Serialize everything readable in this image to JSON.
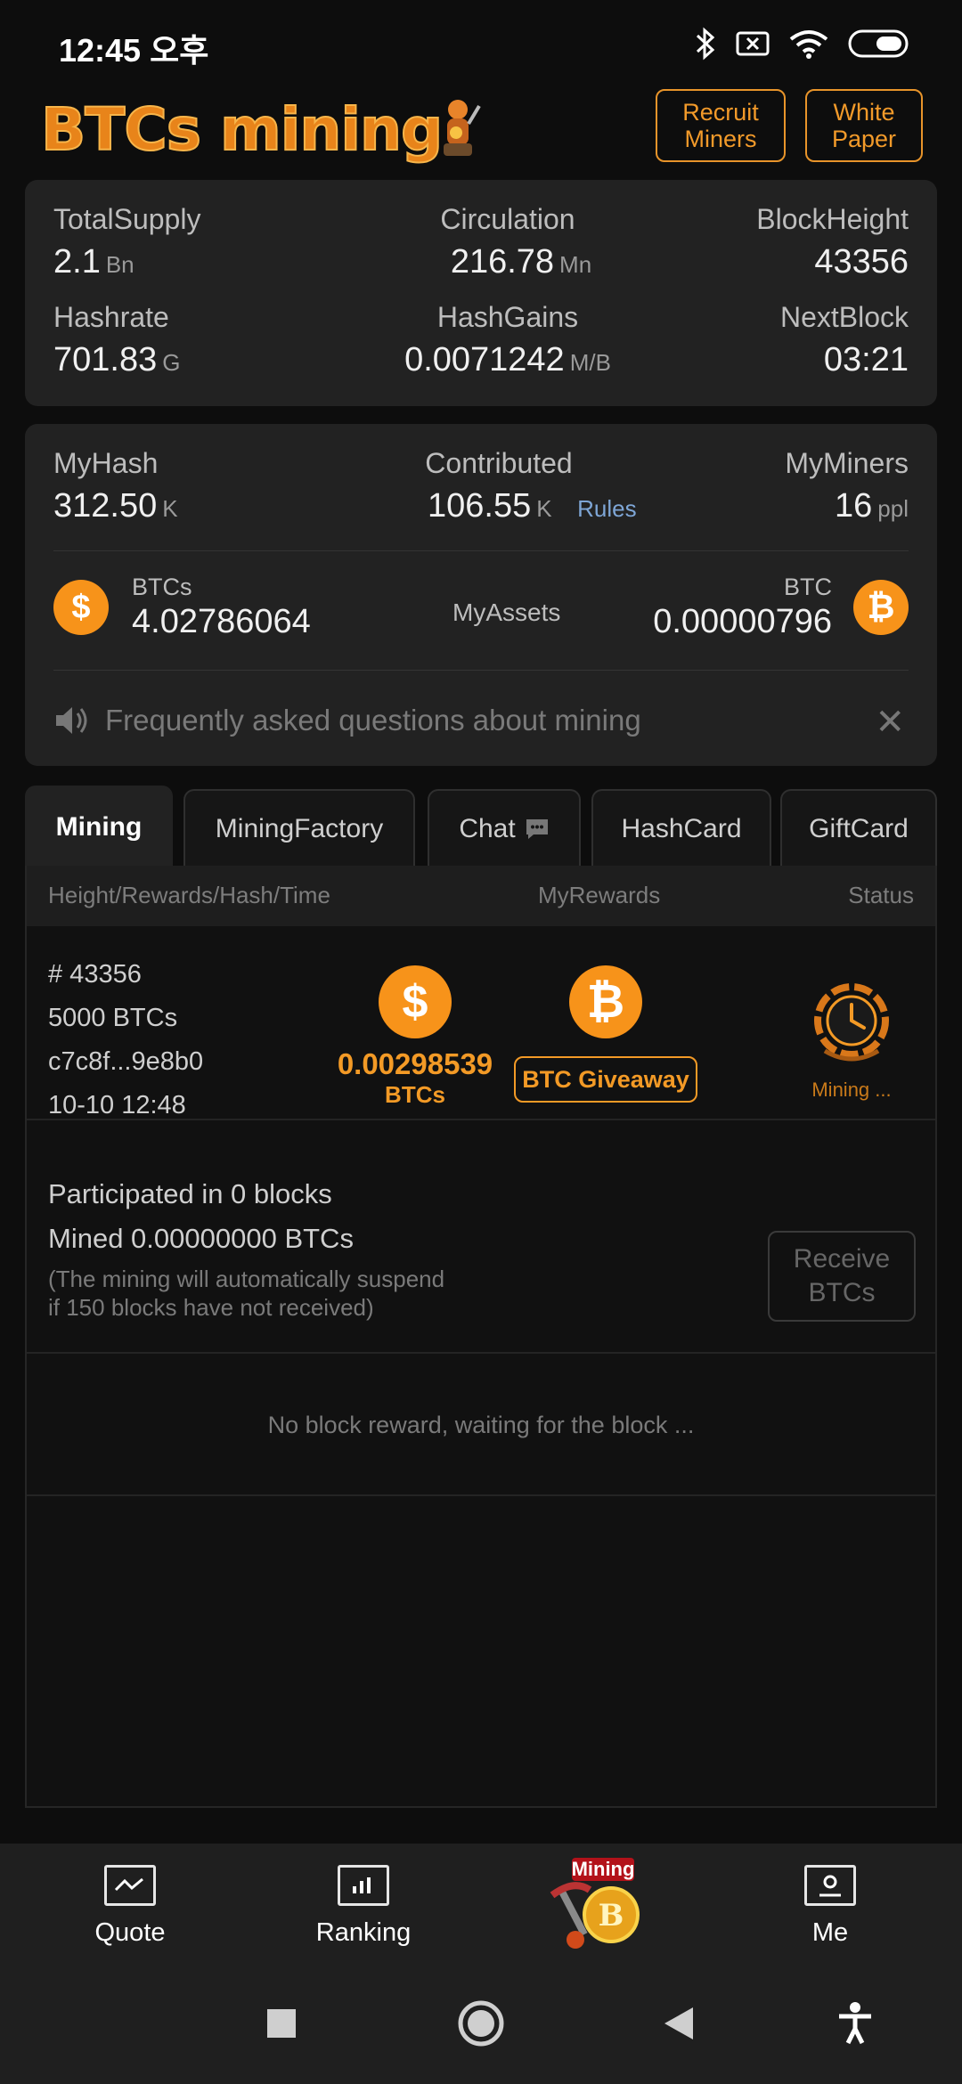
{
  "status_bar": {
    "time": "12:45 오후"
  },
  "header": {
    "logo_text": "BTCs mining",
    "recruit_label": "Recruit Miners",
    "whitepaper_label": "White Paper"
  },
  "stats": {
    "total_supply": {
      "label": "TotalSupply",
      "value": "2.1",
      "unit": "Bn"
    },
    "circulation": {
      "label": "Circulation",
      "value": "216.78",
      "unit": "Mn"
    },
    "block_height": {
      "label": "BlockHeight",
      "value": "43356"
    },
    "hashrate": {
      "label": "Hashrate",
      "value": "701.83",
      "unit": "G"
    },
    "hash_gains": {
      "label": "HashGains",
      "value": "0.0071242",
      "unit": "M/B"
    },
    "next_block": {
      "label": "NextBlock",
      "value": "03:21"
    }
  },
  "my": {
    "my_hash": {
      "label": "MyHash",
      "value": "312.50",
      "unit": "K"
    },
    "contributed": {
      "label": "Contributed",
      "value": "106.55",
      "unit": "K",
      "rules": "Rules"
    },
    "my_miners": {
      "label": "MyMiners",
      "value": "16",
      "unit": "ppl"
    },
    "btcs": {
      "label": "BTCs",
      "value": "4.02786064",
      "icon": "$"
    },
    "assets_label": "MyAssets",
    "btc": {
      "label": "BTC",
      "value": "0.00000796",
      "icon": "₿"
    },
    "faq": "Frequently asked questions about mining",
    "close": "✕"
  },
  "tabs": {
    "mining": "Mining",
    "factory": "MiningFactory",
    "chat": "Chat",
    "hashcard": "HashCard",
    "giftcard": "GiftCard"
  },
  "table": {
    "col1": "Height/Rewards/Hash/Time",
    "col2": "MyRewards",
    "col3": "Status",
    "row": {
      "height": "# 43356",
      "rewards": "5000 BTCs",
      "hash": "c7c8f...9e8b0",
      "time": "10-10 12:48",
      "btcs_icon": "$",
      "my_amount": "0.00298539",
      "my_unit": "BTCs",
      "btc_icon": "₿",
      "giveaway": "BTC Giveaway",
      "status": "Mining ..."
    }
  },
  "participation": {
    "line1": "Participated in 0 blocks",
    "line2": "Mined 0.00000000 BTCs",
    "note1": "(The mining will automatically suspend",
    "note2": "if 150 blocks have not received)",
    "receive": "Receive BTCs"
  },
  "empty_message": "No block reward, waiting for the block ...",
  "bottom_nav": {
    "quote": "Quote",
    "ranking": "Ranking",
    "mining_badge": "Mining",
    "mining_coin": "B",
    "me": "Me"
  },
  "colors": {
    "accent": "#f7931a",
    "background": "#0d0d0d",
    "card": "#222222"
  }
}
